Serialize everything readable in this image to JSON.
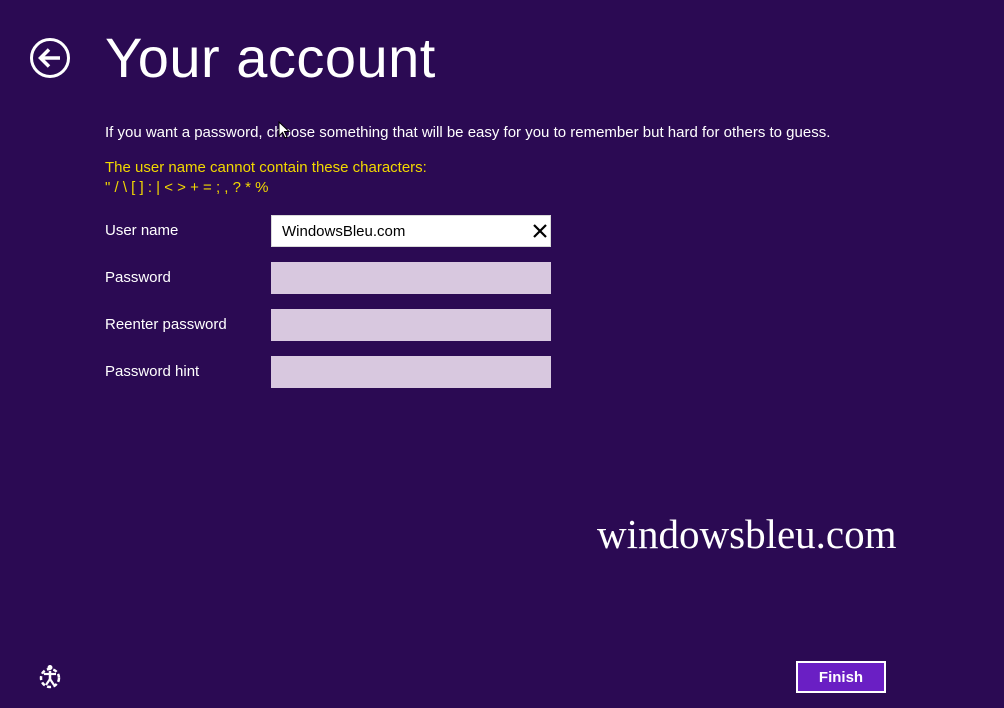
{
  "header": {
    "title": "Your account",
    "back_icon": "back-arrow-icon"
  },
  "intro_text": "If you want a password, choose something that will be easy for you to remember but hard for others to guess.",
  "warning": {
    "line1": "The user name cannot contain these characters:",
    "line2": "\" / \\ [ ] : | < > + = ; , ? * %",
    "color": "#f2d800"
  },
  "form": {
    "username": {
      "label": "User name",
      "value": "WindowsBleu.com",
      "clear_icon": "close-icon"
    },
    "password": {
      "label": "Password",
      "value": ""
    },
    "reenter_password": {
      "label": "Reenter password",
      "value": ""
    },
    "password_hint": {
      "label": "Password hint",
      "value": ""
    }
  },
  "watermark": "windowsbleu.com",
  "footer": {
    "ease_of_access_icon": "ease-of-access-icon",
    "finish_label": "Finish"
  },
  "colors": {
    "background": "#2b0a53",
    "field_inactive": "#d8c8df",
    "button_accent": "#6a1fc4"
  }
}
